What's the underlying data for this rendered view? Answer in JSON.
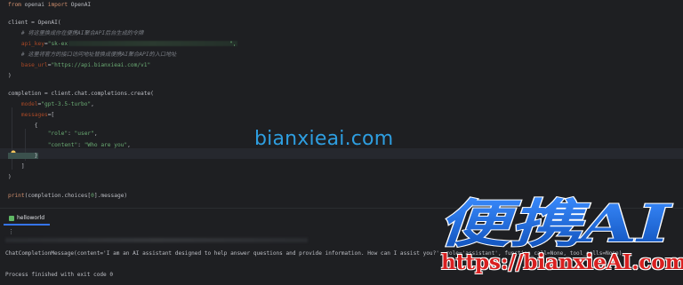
{
  "editor": {
    "lines": [
      {
        "parts": [
          {
            "t": "from ",
            "c": "kw"
          },
          {
            "t": "openai "
          },
          {
            "t": "import ",
            "c": "kw"
          },
          {
            "t": "OpenAI"
          }
        ]
      },
      {
        "parts": [
          {
            "t": "client = OpenAI("
          }
        ]
      },
      {
        "parts": [
          {
            "t": "    # 将这里换成你在便携AI聚合API后台生成的令牌",
            "c": "cmt"
          }
        ]
      },
      {
        "parts": [
          {
            "t": "    api_key",
            "c": "param"
          },
          {
            "t": "="
          },
          {
            "t": "\"sk-ex",
            "c": "str"
          }
        ]
      },
      {
        "parts": [
          {
            "t": "\",",
            "c": "str"
          }
        ]
      },
      {
        "parts": [
          {
            "t": "    # 这里将官方的接口访问地址替换成便携AI聚合API的入口地址",
            "c": "cmt"
          }
        ]
      },
      {
        "parts": [
          {
            "t": "    base_url",
            "c": "param"
          },
          {
            "t": "="
          },
          {
            "t": "\"https://api.bianxieai.com/v1\"",
            "c": "str"
          }
        ]
      },
      {
        "parts": [
          {
            "t": ")"
          }
        ]
      },
      {
        "parts": [
          {
            "t": "completion = client.chat.completions.create("
          }
        ]
      },
      {
        "parts": [
          {
            "t": "    model",
            "c": "param"
          },
          {
            "t": "="
          },
          {
            "t": "\"gpt-3.5-turbo\"",
            "c": "str"
          },
          {
            "t": ","
          }
        ]
      },
      {
        "parts": [
          {
            "t": "    messages",
            "c": "param"
          },
          {
            "t": "=["
          }
        ]
      },
      {
        "parts": [
          {
            "t": "        {"
          }
        ]
      },
      {
        "parts": [
          {
            "t": "            "
          },
          {
            "t": "\"role\"",
            "c": "str"
          },
          {
            "t": ": "
          },
          {
            "t": "\"user\"",
            "c": "str"
          },
          {
            "t": ","
          }
        ]
      },
      {
        "parts": [
          {
            "t": "            "
          },
          {
            "t": "\"content\"",
            "c": "str"
          },
          {
            "t": ": "
          },
          {
            "t": "\"Who are you\"",
            "c": "str"
          },
          {
            "t": ","
          }
        ]
      },
      {
        "parts": [
          {
            "t": "        }"
          }
        ]
      },
      {
        "parts": [
          {
            "t": "    ]"
          }
        ]
      },
      {
        "parts": [
          {
            "t": ")"
          }
        ]
      },
      {
        "parts": [
          {
            "t": "print",
            "c": "kw"
          },
          {
            "t": "(completion.choices["
          },
          {
            "t": "0",
            "c": "str"
          },
          {
            "t": "].message)"
          }
        ]
      }
    ]
  },
  "watermark": "bianxieai.com",
  "run_panel": {
    "tab_label": "helloworld",
    "more_icon": "⋮",
    "output_line": "ChatCompletionMessage(content='I am an AI assistant designed to help answer questions and provide information. How can I assist you?', role='assistant', function_call=None, tool_calls=None)",
    "exit_line": "Process finished with exit code 0"
  },
  "logo": {
    "text": "便携AI",
    "url": "https://bianxieAI.com"
  },
  "colors": {
    "background": "#1e1f22",
    "keyword": "#cf8e6d",
    "string": "#6aab73",
    "param": "#aa4926",
    "comment": "#7a7e85",
    "watermark": "#2e9ee0",
    "logo_blue": "#1e6fd9",
    "logo_red": "#d92020"
  },
  "icons": {
    "bulb": "lightbulb-icon",
    "run_tab": "python-run-icon",
    "more": "more-vertical-icon"
  }
}
